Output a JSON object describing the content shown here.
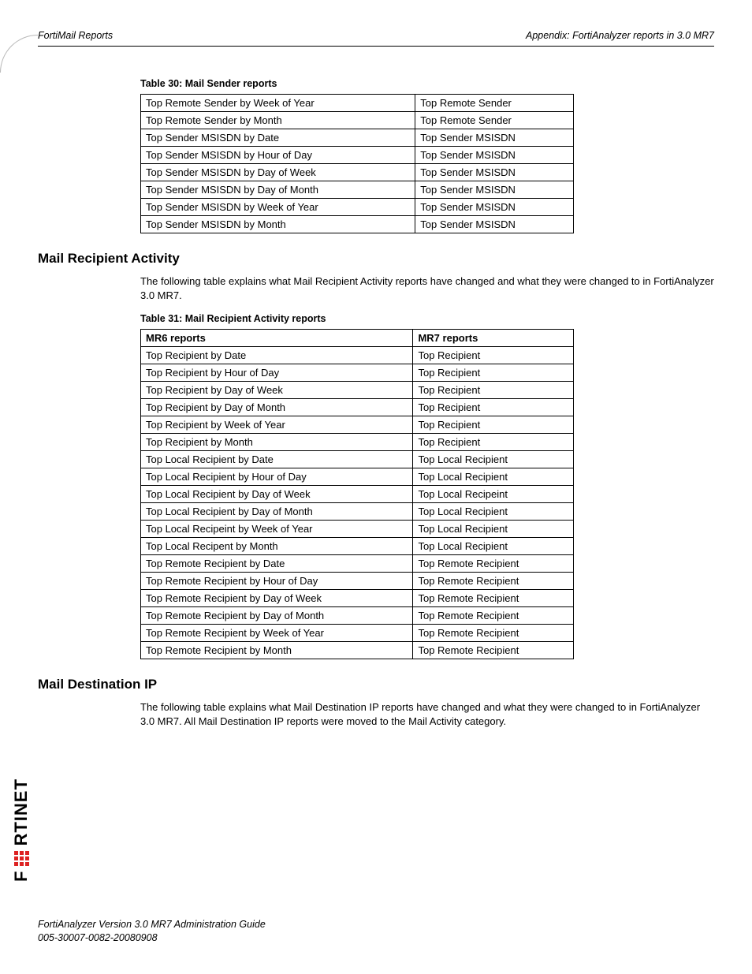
{
  "header": {
    "left": "FortiMail Reports",
    "right": "Appendix: FortiAnalyzer reports in 3.0 MR7"
  },
  "table30": {
    "caption": "Table 30: Mail Sender reports",
    "rows": [
      [
        "Top Remote Sender by Week of Year",
        "Top Remote Sender"
      ],
      [
        "Top Remote Sender by Month",
        "Top Remote Sender"
      ],
      [
        "Top Sender MSISDN by Date",
        "Top Sender MSISDN"
      ],
      [
        "Top Sender MSISDN by Hour of Day",
        "Top Sender MSISDN"
      ],
      [
        "Top Sender MSISDN by Day of Week",
        "Top Sender MSISDN"
      ],
      [
        "Top Sender MSISDN by Day of Month",
        "Top Sender MSISDN"
      ],
      [
        "Top Sender MSISDN by Week of Year",
        "Top Sender MSISDN"
      ],
      [
        "Top Sender MSISDN by Month",
        "Top Sender MSISDN"
      ]
    ]
  },
  "section_recipient": {
    "heading": "Mail Recipient Activity",
    "para": "The following table explains what Mail Recipient Activity reports have changed and what they were changed to in FortiAnalyzer 3.0 MR7."
  },
  "table31": {
    "caption": "Table 31: Mail Recipient Activity reports",
    "head": [
      "MR6 reports",
      "MR7 reports"
    ],
    "rows": [
      [
        "Top Recipient by Date",
        "Top Recipient"
      ],
      [
        "Top Recipient by Hour of Day",
        "Top Recipient"
      ],
      [
        "Top Recipient by Day of Week",
        "Top Recipient"
      ],
      [
        "Top Recipient by Day of Month",
        "Top Recipient"
      ],
      [
        "Top Recipient by Week of Year",
        "Top Recipient"
      ],
      [
        "Top Recipient by Month",
        "Top Recipient"
      ],
      [
        "Top Local Recipient by Date",
        "Top Local Recipient"
      ],
      [
        "Top Local Recipient by Hour of Day",
        "Top Local Recipient"
      ],
      [
        "Top Local Recipient by Day of Week",
        "Top Local Recipeint"
      ],
      [
        "Top Local Recipient by Day of Month",
        "Top Local Recipient"
      ],
      [
        "Top Local Recipeint by Week of Year",
        "Top Local Recipient"
      ],
      [
        "Top Local Recipent by Month",
        "Top Local Recipient"
      ],
      [
        "Top Remote Recipient by Date",
        "Top Remote Recipient"
      ],
      [
        "Top Remote Recipient by Hour of Day",
        "Top Remote Recipient"
      ],
      [
        "Top Remote Recipient by Day of Week",
        "Top Remote Recipient"
      ],
      [
        "Top Remote Recipient by Day of Month",
        "Top Remote Recipient"
      ],
      [
        "Top Remote Recipient by Week of Year",
        "Top Remote Recipient"
      ],
      [
        "Top Remote Recipient by Month",
        "Top Remote Recipient"
      ]
    ]
  },
  "section_destip": {
    "heading": "Mail Destination IP",
    "para": "The following table explains what Mail Destination IP reports have changed and what they were changed to in FortiAnalyzer 3.0 MR7. All Mail Destination IP reports were moved to the Mail Activity category."
  },
  "footer": {
    "line1": "FortiAnalyzer Version 3.0 MR7 Administration Guide",
    "line2": "005-30007-0082-20080908"
  },
  "logo": {
    "text_part1": "F",
    "text_part2": "RTINET"
  }
}
